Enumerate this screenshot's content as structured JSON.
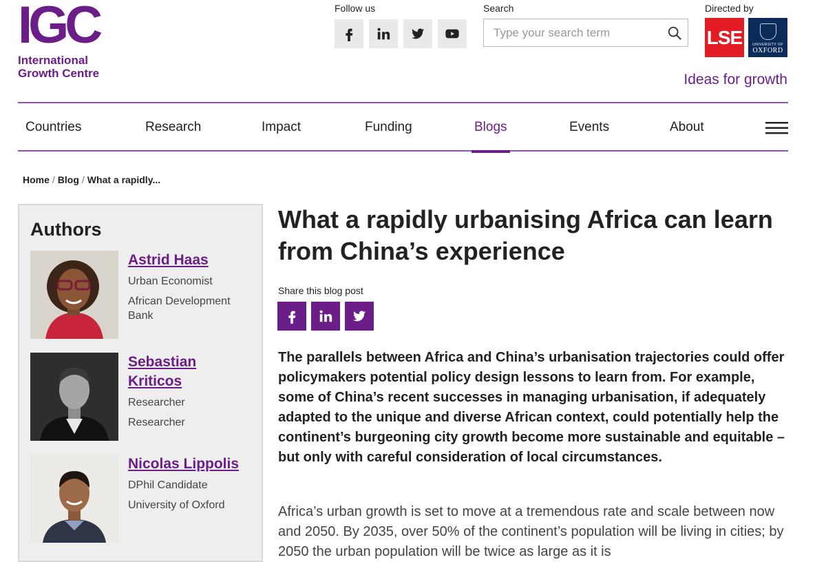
{
  "logo": {
    "letters": "IGC",
    "line1": "International",
    "line2": "Growth Centre"
  },
  "follow": {
    "label": "Follow us",
    "icons": [
      "facebook-icon",
      "linkedin-icon",
      "twitter-icon",
      "youtube-icon"
    ]
  },
  "search": {
    "label": "Search",
    "placeholder": "Type your search term"
  },
  "directed": {
    "label": "Directed by",
    "lse": "LSE",
    "oxford_small": "UNIVERSITY OF",
    "oxford_big": "OXFORD"
  },
  "tagline": "Ideas for growth",
  "nav": {
    "items": [
      "Countries",
      "Research",
      "Impact",
      "Funding",
      "Blogs",
      "Events",
      "About"
    ],
    "active": "Blogs"
  },
  "breadcrumb": {
    "home": "Home",
    "blog": "Blog",
    "current": "What a rapidly..."
  },
  "authors": {
    "heading": "Authors",
    "list": [
      {
        "name": "Astrid Haas",
        "role1": "Urban Economist",
        "role2": "African Development Bank"
      },
      {
        "name": "Sebastian Kriticos",
        "role1": "Researcher",
        "role2": "Researcher"
      },
      {
        "name": "Nicolas Lippolis",
        "role1": "DPhil Candidate",
        "role2": "University of Oxford"
      }
    ]
  },
  "article": {
    "title": "What a rapidly urbanising Africa can learn from China’s experience",
    "share_label": "Share this blog post",
    "lead": "The parallels between Africa and China’s urbanisation trajectories could offer policymakers potential policy design lessons to learn from. For example, some of China’s recent successes in managing urbanisation, if adequately adapted to the unique and diverse African context, could potentially help the continent’s burgeoning city growth become more sustainable and equitable – but only with careful consideration of local circumstances.",
    "body": "Africa’s urban growth is set to move at a tremendous rate and scale between now and 2050. By 2035, over 50% of the continent’s population will be living in cities; by 2050 the urban population will be twice as large as it is"
  },
  "colors": {
    "brand_purple": "#6b1e87",
    "lse_red": "#e31b23",
    "oxford_blue": "#0b2b5b"
  }
}
